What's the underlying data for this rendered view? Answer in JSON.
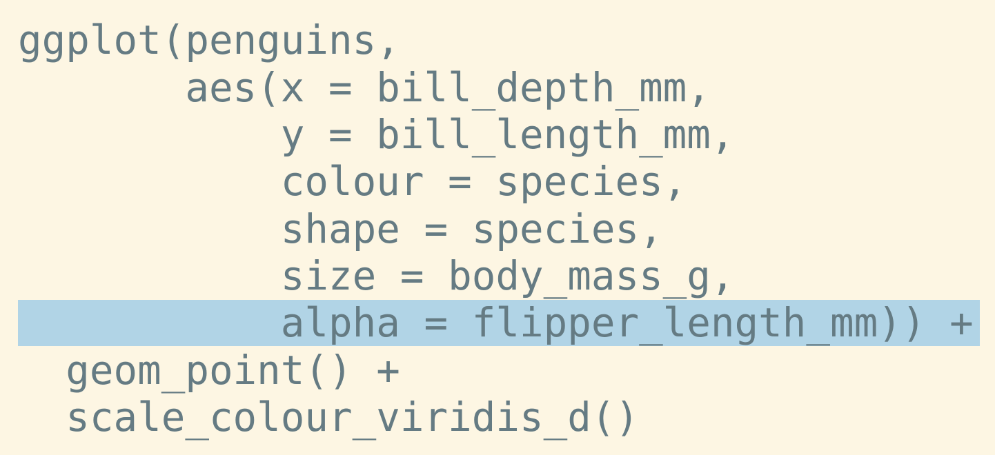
{
  "code": {
    "lines": [
      "ggplot(penguins,",
      "       aes(x = bill_depth_mm,",
      "           y = bill_length_mm,",
      "           colour = species,",
      "           shape = species,",
      "           size = body_mass_g,",
      "           alpha = flipper_length_mm)) +",
      "  geom_point() +",
      "  scale_colour_viridis_d()"
    ],
    "highlighted_line": 7
  },
  "colors": {
    "background": "#fdf6e3",
    "text": "#657b83",
    "highlight": "#b1d4e6"
  }
}
